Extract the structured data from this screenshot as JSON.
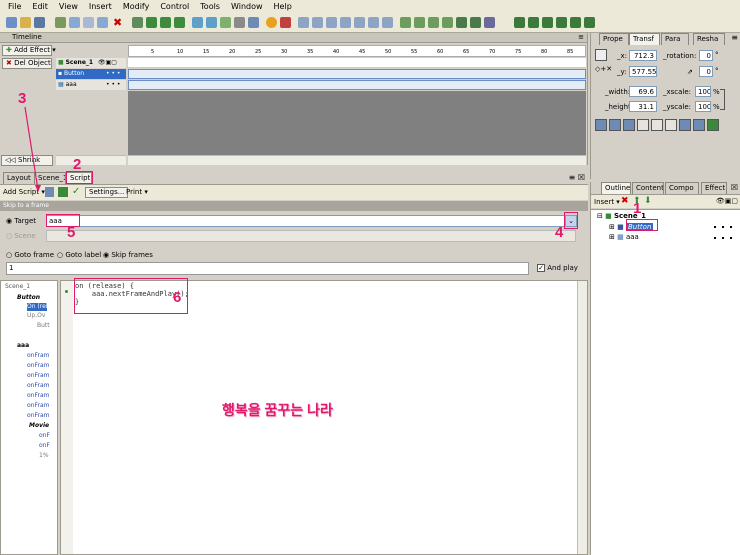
{
  "menu": [
    "File",
    "Edit",
    "View",
    "Insert",
    "Modify",
    "Control",
    "Tools",
    "Window",
    "Help"
  ],
  "timeline": {
    "title": "Timeline",
    "add_effect": "Add Effect",
    "del_object": "Del Object",
    "layers": [
      "Scene_1",
      "Button",
      "aaa"
    ],
    "frame_numbers": [
      "5",
      "10",
      "15",
      "20",
      "25",
      "30",
      "35",
      "40",
      "45",
      "50",
      "55",
      "60",
      "65",
      "70",
      "75",
      "80",
      "85"
    ],
    "shrink": "Shrink"
  },
  "script_panel": {
    "tabs": [
      "Layout",
      "Scene_1",
      "Script"
    ],
    "add_script": "Add Script",
    "settings": "Settings...",
    "print": "Print",
    "section_title": "Skip to a frame",
    "target_label": "Target",
    "target_value": "aaa",
    "scene_label": "Scene",
    "goto_frame": "Goto frame",
    "goto_label": "Goto label",
    "skip_frames": "Skip frames",
    "frame_value": "1",
    "and_play": "And play"
  },
  "tree": {
    "items": [
      "Scene_1",
      "Button",
      "On (rel",
      "Up,Ov",
      "Butt",
      "aaa",
      "onFram",
      "onFram",
      "onFram",
      "onFram",
      "onFram",
      "onFram",
      "onFram",
      "Movie",
      "onF",
      "onF",
      "1%"
    ]
  },
  "code_lines": [
    "on (release) {",
    "    aaa.nextFrameAndPlay();",
    "}"
  ],
  "overlay_text": "행복을 꿈꾸는 나라",
  "markers": [
    "1",
    "2",
    "3",
    "4",
    "5",
    "6"
  ],
  "transform_panel": {
    "tabs": [
      "Prope",
      "Transf",
      "Para",
      "Resha"
    ],
    "x_label": "_x:",
    "x_value": "712.3",
    "y_label": "_y:",
    "y_value": "577.55",
    "rotation_label": "_rotation:",
    "rotation_value": "0",
    "skew_value": "0",
    "width_label": "_width:",
    "width_value": "69.6",
    "height_label": "_height:",
    "height_value": "31.1",
    "xscale_label": "_xscale:",
    "xscale_value": "100",
    "yscale_label": "_yscale:",
    "yscale_value": "100",
    "deg": "°",
    "pct": "%"
  },
  "outline_panel": {
    "tabs": [
      "Outline",
      "Content",
      "Compo",
      "Effect"
    ],
    "insert": "Insert",
    "scene": "Scene_1",
    "button": "Button",
    "aaa": "aaa"
  },
  "colors": {
    "accent": "#e0196b",
    "selection": "#316ac5",
    "panel": "#d4d0c8"
  }
}
